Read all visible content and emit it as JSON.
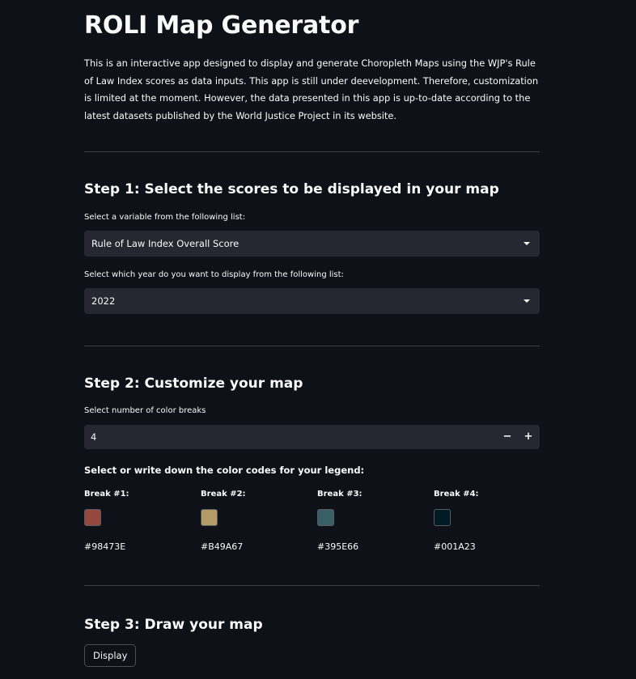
{
  "app": {
    "title": "ROLI Map Generator",
    "intro": "This is an interactive app designed to display and generate Choropleth Maps using the WJP's Rule of Law Index scores as data inputs. This app is still under deevelopment. Therefore, customization is limited at the moment. However, the data presented in this app is up-to-date according to the latest datasets published by the World Justice Project in its website."
  },
  "step1": {
    "heading": "Step 1: Select the scores to be displayed in your map",
    "variable_label": "Select a variable from the following list:",
    "variable_value": "Rule of Law Index Overall Score",
    "year_label": "Select which year do you want to display from the following list:",
    "year_value": "2022"
  },
  "step2": {
    "heading": "Step 2: Customize your map",
    "breaks_label": "Select number of color breaks",
    "breaks_value": "4",
    "minus_label": "−",
    "plus_label": "+",
    "legend_label": "Select or write down the color codes for your legend:",
    "breaks": [
      {
        "label": "Break #1:",
        "color": "#98473E",
        "hex": "#98473E"
      },
      {
        "label": "Break #2:",
        "color": "#B49A67",
        "hex": "#B49A67"
      },
      {
        "label": "Break #3:",
        "color": "#395E66",
        "hex": "#395E66"
      },
      {
        "label": "Break #4:",
        "color": "#001A23",
        "hex": "#001A23"
      }
    ]
  },
  "step3": {
    "heading": "Step 3: Draw your map",
    "button_label": "Display"
  }
}
